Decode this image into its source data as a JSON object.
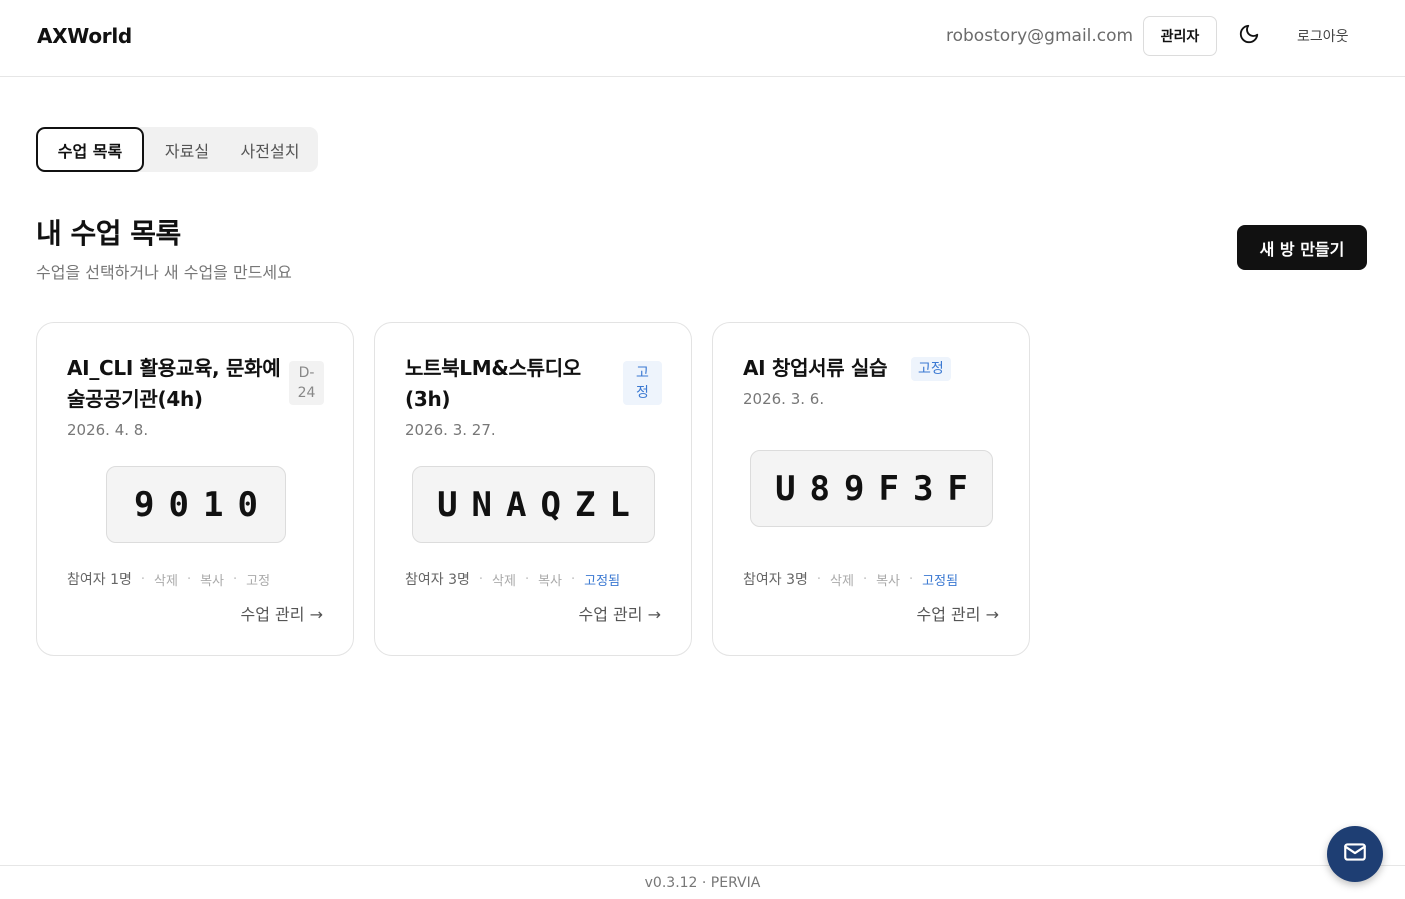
{
  "header": {
    "brand": "AXWorld",
    "email": "robostory@gmail.com",
    "admin_label": "관리자",
    "theme_icon": "moon-icon",
    "logout_label": "로그아웃"
  },
  "tabs": [
    {
      "label": "수업 목록",
      "active": true
    },
    {
      "label": "자료실",
      "active": false
    },
    {
      "label": "사전설치",
      "active": false
    }
  ],
  "main": {
    "title": "내 수업 목록",
    "subtitle": "수업을 선택하거나 새 수업을 만드세요",
    "new_room_label": "새 방 만들기"
  },
  "classes": [
    {
      "title": "AI_CLI 활용교육, 문화예술공공기관(4h)",
      "badge": "D-24",
      "date": "2026. 4. 8.",
      "code": "9010",
      "participants": "참여자 1명",
      "delete_label": "삭제",
      "copy_label": "복사",
      "pin_label": "고정",
      "pinned": false,
      "manage_label": "수업 관리 →"
    },
    {
      "title": "노트북LM&스튜디오(3h)",
      "badge": "고정",
      "date": "2026. 3. 27.",
      "code": "UNAQZL",
      "participants": "참여자 3명",
      "delete_label": "삭제",
      "copy_label": "복사",
      "pin_label": "고정됨",
      "pinned": true,
      "manage_label": "수업 관리 →"
    },
    {
      "title": "AI 창업서류 실습",
      "badge": "고정",
      "date": "2026. 3. 6.",
      "code": "U89F3F",
      "participants": "참여자 3명",
      "delete_label": "삭제",
      "copy_label": "복사",
      "pin_label": "고정됨",
      "pinned": true,
      "manage_label": "수업 관리 →"
    }
  ],
  "footer": {
    "version": "v0.3.12 · PERVIA"
  },
  "fab": {
    "icon": "mail-icon"
  },
  "colors": {
    "accent_blue": "#3b79d2",
    "fab_bg": "#1e3e73",
    "primary_button": "#111111"
  }
}
